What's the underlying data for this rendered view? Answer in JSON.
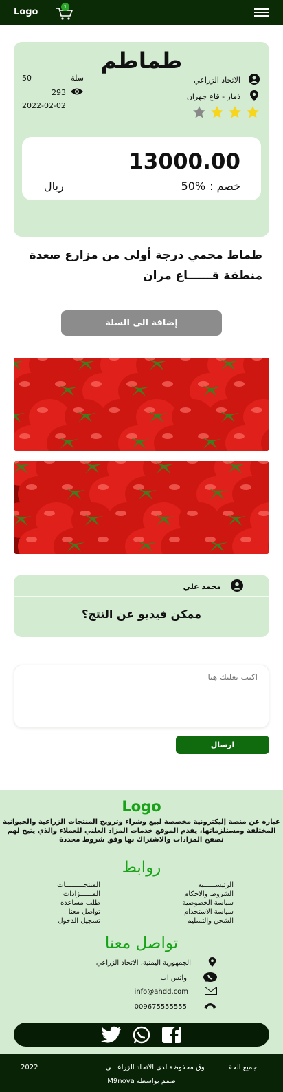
{
  "header": {
    "logo": "Logo",
    "cart_count": "1"
  },
  "product": {
    "title": "طماطم",
    "quantity": "50",
    "unit": "سلة",
    "views": "293",
    "date": "2022-02-02",
    "seller": "الاتحاد الزراعي",
    "location": "ذمار - قاع جهران",
    "rating": 3,
    "rating_max": 4,
    "price": "13000.00",
    "discount_label": "خصم :",
    "discount_value": "50%",
    "currency": "ريال",
    "description": "طماط محمي درجة أولى من مزارع صعدة منطقة قــــــاع مران",
    "add_to_cart": "إضافة الى السلة"
  },
  "comment": {
    "author": "محمد علي",
    "text": "ممكن فيديو عن النتج؟",
    "input_placeholder": "اكتب تعليك هنا",
    "send_label": "ارسال"
  },
  "footer": {
    "logo": "Logo",
    "about": "عبارة عن منصة إليكترونية مخصصة لبيع وشراء وترويج المنتجات الزراعية والحيوانية المختلفة ومستلزماتها، يقدم الموقع خدمات المزاد العلني للعملاء والذي يتيح لهم تصفح المزادات والاشتراك بها وفق شروط محددة",
    "links_title": "روابط",
    "links_right": [
      "الرئيســــــية",
      "الشروط والاحكام",
      "سياسة الخصوصية",
      "سياسة الاستخدام",
      "الشحن والتسليم"
    ],
    "links_left": [
      "المنتجـــــــــات",
      "المــــــزادات",
      "طلب مساعدة",
      "تواصل معنا",
      "تسجيل الدخول"
    ],
    "contact_title": "تواصل معنا",
    "contact": {
      "address": "الجمهورية اليمنية، الاتحاد الزراعي",
      "whatsapp": "واتس اب",
      "email": "info@ahdd.com",
      "phone": "009675555555"
    },
    "rights": "جميع الحقــــــــــــوق محفوظة لدى الاتحاد الزراعـــي",
    "year": "2022",
    "credit": "صمم بواسطة M9nova"
  },
  "colors": {
    "header_bg": "#0b2a06",
    "card_bg": "#d3ebd0",
    "accent_green": "#18a218",
    "button_green": "#106b0f",
    "star_gold": "#f7d51d"
  }
}
